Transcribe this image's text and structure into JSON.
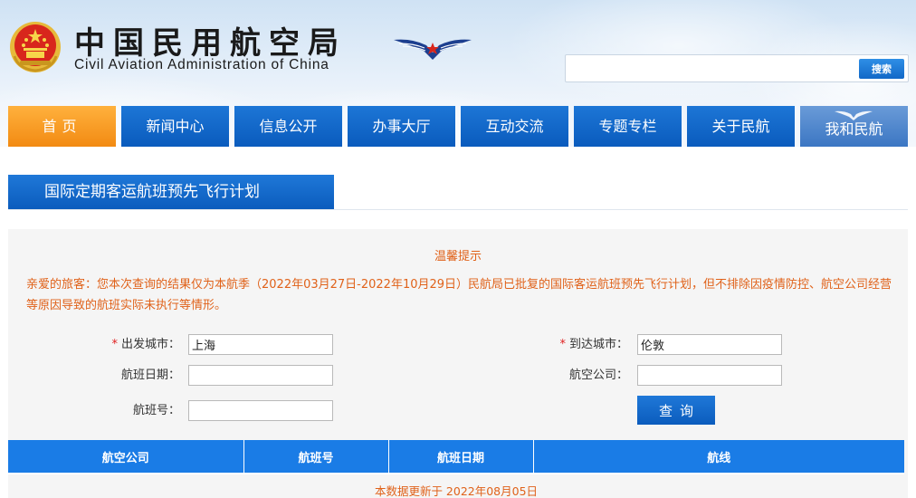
{
  "header": {
    "title_cn": "中国民用航空局",
    "title_en": "Civil Aviation Administration of China",
    "search": {
      "placeholder": "",
      "button_label": "搜索"
    }
  },
  "nav": {
    "items": [
      {
        "label": "首页"
      },
      {
        "label": "新闻中心"
      },
      {
        "label": "信息公开"
      },
      {
        "label": "办事大厅"
      },
      {
        "label": "互动交流"
      },
      {
        "label": "专题专栏"
      },
      {
        "label": "关于民航"
      },
      {
        "label": "我和民航"
      }
    ]
  },
  "section": {
    "title": "国际定期客运航班预先飞行计划"
  },
  "tips": {
    "title": "温馨提示",
    "text": "亲爱的旅客：您本次查询的结果仅为本航季（2022年03月27日-2022年10月29日）民航局已批复的国际客运航班预先飞行计划，但不排除因疫情防控、航空公司经营等原因导致的航班实际未执行等情形。"
  },
  "form": {
    "required_mark": "*",
    "departure": {
      "label": "出发城市：",
      "value": "上海"
    },
    "arrival": {
      "label": "到达城市：",
      "value": "伦敦"
    },
    "date": {
      "label": "航班日期：",
      "value": ""
    },
    "airline": {
      "label": "航空公司：",
      "value": ""
    },
    "flight_no": {
      "label": "航班号：",
      "value": ""
    },
    "query_label": "查询"
  },
  "table": {
    "columns": [
      "航空公司",
      "航班号",
      "航班日期",
      "航线"
    ]
  },
  "update_note": "本数据更新于 2022年08月05日",
  "colors": {
    "nav_blue": "#0a5bbd",
    "nav_active": "#f28a12",
    "notice_orange": "#e0621a",
    "table_header": "#1a7ce6"
  }
}
